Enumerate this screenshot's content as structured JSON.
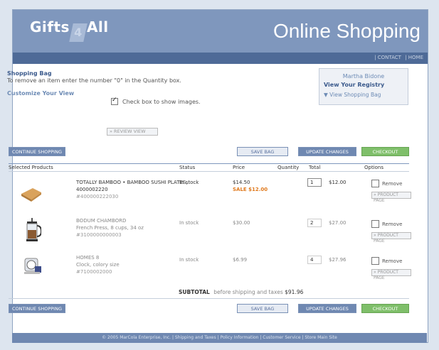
{
  "header": {
    "logo_left": "Gifts",
    "logo_mid": "4",
    "logo_right": "All",
    "title": "Online Shopping",
    "links": [
      "| CONTACT",
      "| HOME"
    ]
  },
  "bag": {
    "title": "Shopping Bag",
    "hint": "To remove an item enter the number \"0\" in the Quantity box.",
    "customize": "Customize Your View",
    "show_images_label": "Check box to show images.",
    "review_btn": "» REVIEW VIEW"
  },
  "registry": {
    "name": "Martha Bidone",
    "view_registry": "View Your Registry",
    "view_bag": "▼ View Shopping Bag"
  },
  "buttons": {
    "continue": "CONTINUE SHOPPING",
    "save": "SAVE BAG",
    "update": "UPDATE CHANGES",
    "checkout": "CHECKOUT"
  },
  "table": {
    "headers": [
      "Selected Products",
      "Status",
      "Price",
      "Quantity",
      "Total",
      "Options"
    ]
  },
  "items": [
    {
      "name": "TOTALLY BAMBOO • BAMBOO SUSHI PLATES, 4000002220",
      "sku": "#400000222030",
      "status": "In stock",
      "price": "$14.50",
      "sale": "SALE $12.00",
      "qty": "1",
      "total": "$12.00",
      "remove": "Remove",
      "page": "» PRODUCT PAGE"
    },
    {
      "name": "BODUM CHAMBORD",
      "detail": "French Press, 8 cups, 34 oz",
      "sku": "#3100000000003",
      "status": "In stock",
      "price": "$30.00",
      "qty": "2",
      "total": "$27.00",
      "remove": "Remove",
      "page": "» PRODUCT PAGE"
    },
    {
      "name": "HOMES 8",
      "detail": "Clock, colory size",
      "sku": "#7100002000",
      "status": "In stock",
      "price": "$6.99",
      "qty": "4",
      "total": "$27.96",
      "remove": "Remove",
      "page": "» PRODUCT PAGE"
    }
  ],
  "subtotal": {
    "label": "SUBTOTAL",
    "text": "before shipping and taxes",
    "value": "$91.96"
  },
  "footer": "© 2005 MarCola Enterprise, Inc. | Shipping and Taxes | Policy Information | Customer Service | Store Main Site",
  "colors": {
    "header": "#7f97bd",
    "topbar": "#4e6a97",
    "checkout": "#7fbf6a",
    "sale": "#e07a1e"
  }
}
